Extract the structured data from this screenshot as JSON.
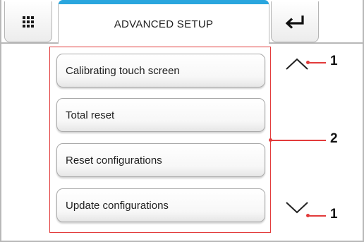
{
  "header": {
    "title": "ADVANCED SETUP",
    "menu_icon": "grid-menu-icon",
    "back_icon": "return-arrow-icon",
    "accent_color": "#2aa6de"
  },
  "options": [
    {
      "label": "Calibrating touch screen"
    },
    {
      "label": "Total reset"
    },
    {
      "label": "Reset configurations"
    },
    {
      "label": "Update configurations"
    }
  ],
  "scroll": {
    "up_icon": "chevron-up-icon",
    "down_icon": "chevron-down-icon"
  },
  "callouts": {
    "scroll_up": "1",
    "options_group": "2",
    "scroll_down": "1",
    "color": "#e23b3b"
  }
}
